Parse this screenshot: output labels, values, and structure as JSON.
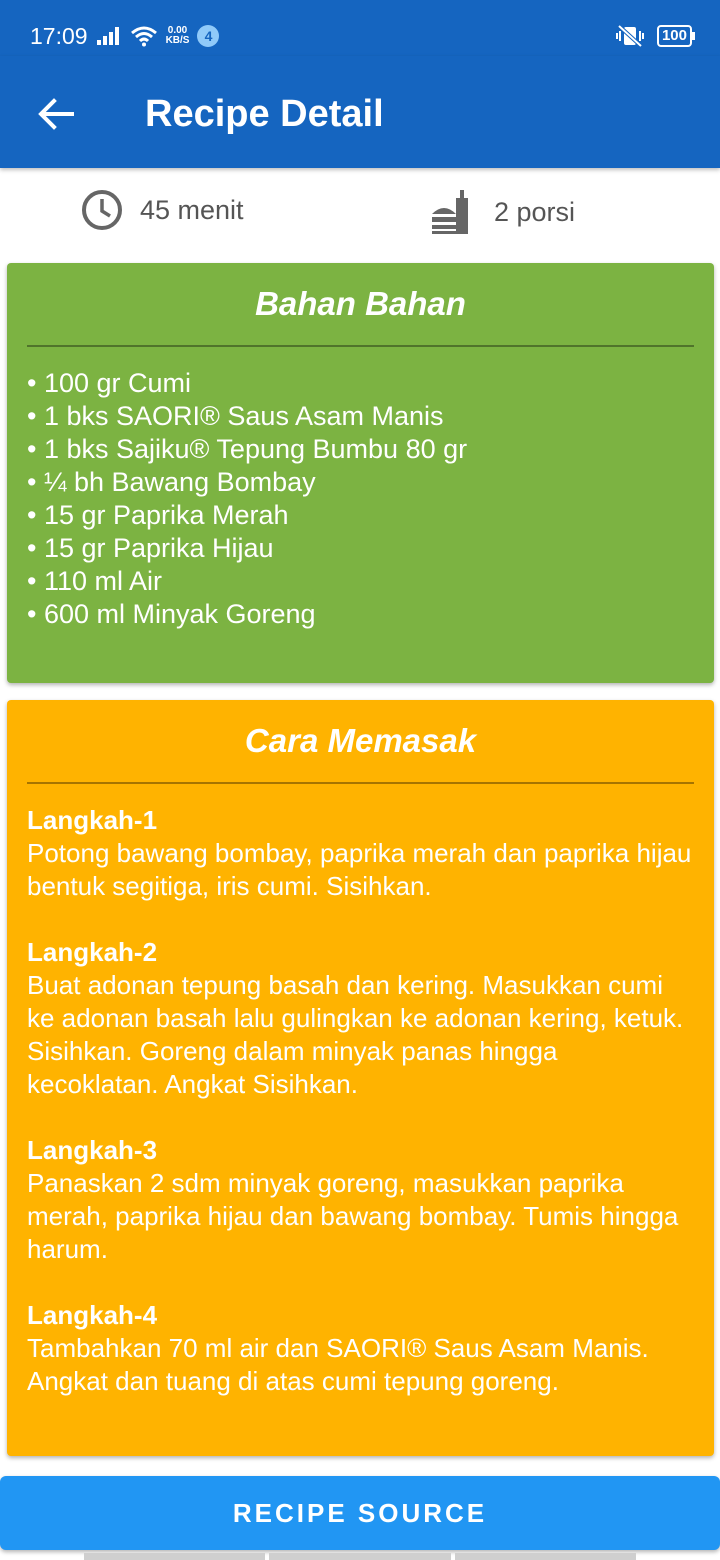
{
  "status_bar": {
    "time": "17:09",
    "net_speed_value": "0.00",
    "net_speed_unit": "KB/S",
    "notification_count": "4",
    "battery": "100"
  },
  "app_bar": {
    "title": "Recipe Detail",
    "back_icon": "arrow-left-icon"
  },
  "info": {
    "time_icon": "clock-icon",
    "time_label": "45 menit",
    "serving_icon": "food-serving-icon",
    "serving_label": "2 porsi"
  },
  "ingredients_card": {
    "title": "Bahan Bahan",
    "color": "#7cb342",
    "items": [
      "• 100 gr Cumi",
      "• 1 bks SAORI® Saus Asam Manis",
      "• 1 bks Sajiku® Tepung Bumbu 80 gr",
      "• ¼ bh Bawang Bombay",
      "• 15 gr Paprika Merah",
      "• 15 gr Paprika Hijau",
      "• 110 ml Air",
      "• 600 ml Minyak Goreng"
    ]
  },
  "steps_card": {
    "title": "Cara Memasak",
    "color": "#ffb300",
    "steps": [
      {
        "title": "Langkah-1",
        "text": "Potong bawang bombay, paprika merah dan paprika hijau bentuk segitiga, iris cumi. Sisihkan."
      },
      {
        "title": "Langkah-2",
        "text": "Buat adonan tepung basah dan kering. Masukkan cumi ke adonan basah lalu gulingkan ke adonan kering, ketuk. Sisihkan. Goreng dalam minyak panas hingga kecoklatan. Angkat Sisihkan."
      },
      {
        "title": "Langkah-3",
        "text": "Panaskan 2 sdm minyak goreng, masukkan paprika merah, paprika hijau dan bawang bombay. Tumis hingga harum."
      },
      {
        "title": "Langkah-4",
        "text": "Tambahkan 70 ml air dan SAORI® Saus Asam Manis. Angkat dan tuang di atas cumi tepung goreng."
      }
    ]
  },
  "source_button": {
    "label": "RECIPE SOURCE",
    "color": "#2196f3"
  }
}
